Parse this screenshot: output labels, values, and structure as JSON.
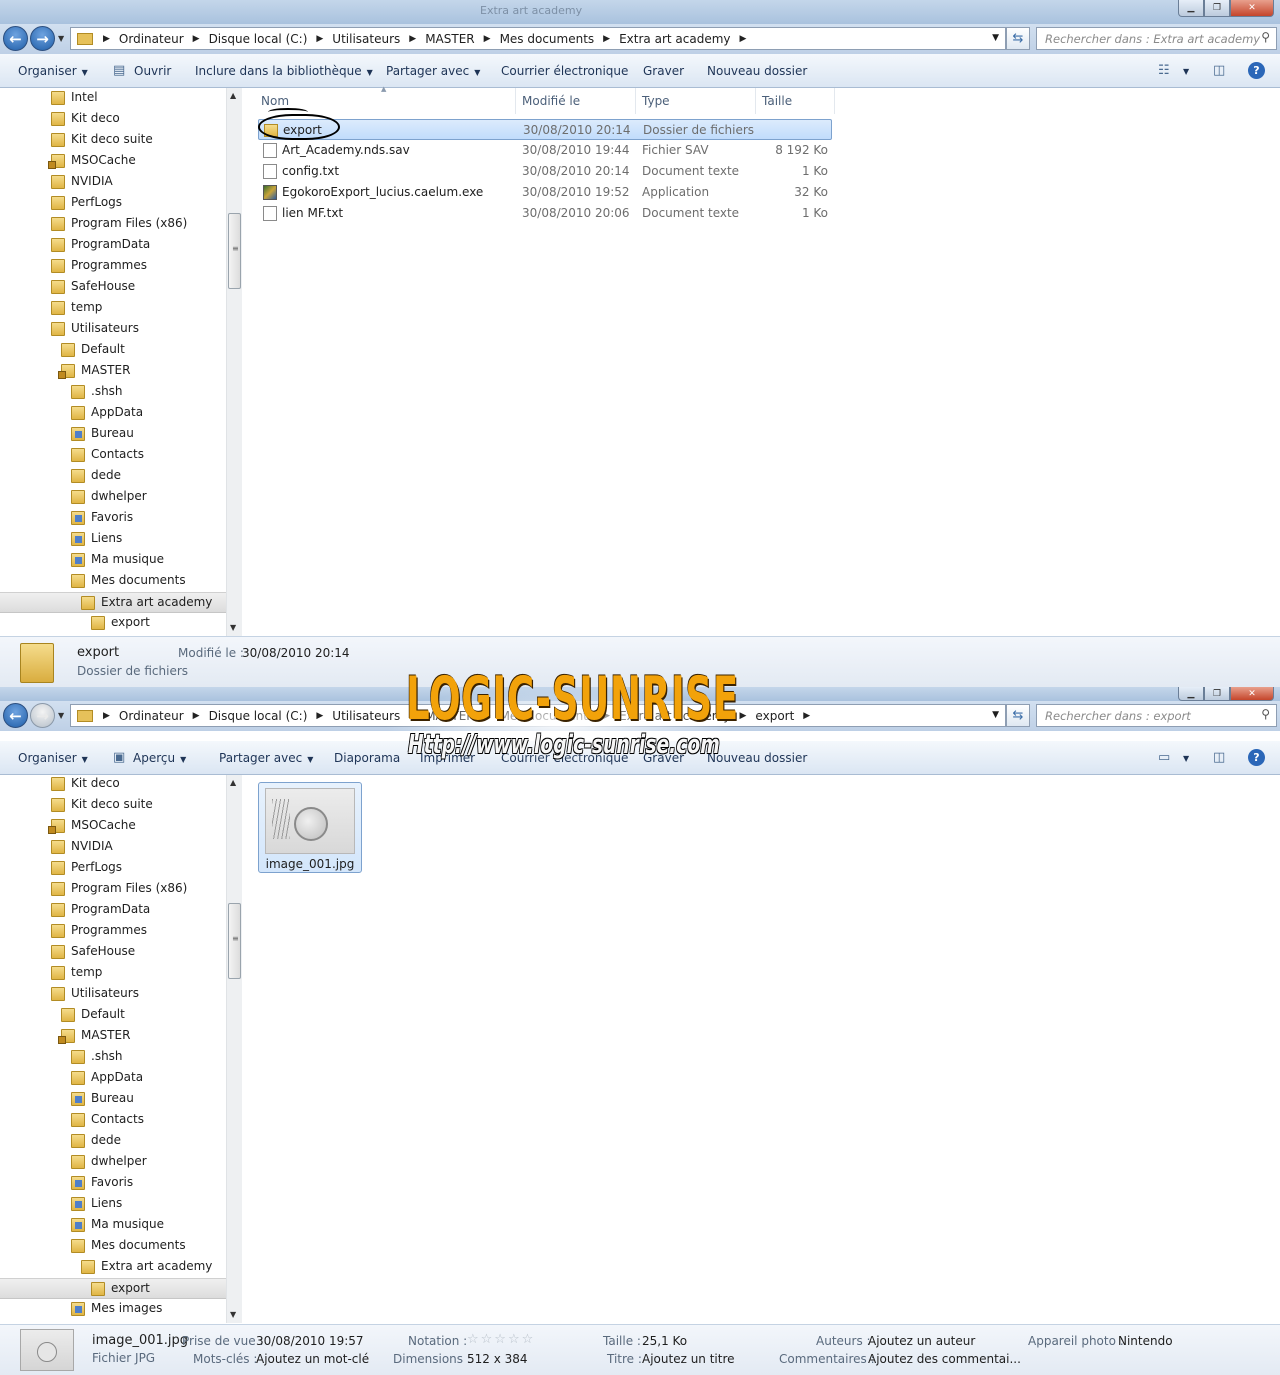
{
  "window1": {
    "title": "Extra art academy",
    "breadcrumb": [
      "Ordinateur",
      "Disque local (C:)",
      "Utilisateurs",
      "MASTER",
      "Mes documents",
      "Extra art academy"
    ],
    "search_placeholder": "Rechercher dans : Extra art academy",
    "toolbar": {
      "organize": "Organiser",
      "open": "Ouvrir",
      "library": "Inclure dans la bibliothèque",
      "share": "Partager avec",
      "email": "Courrier électronique",
      "burn": "Graver",
      "new_folder": "Nouveau dossier"
    },
    "tree": [
      "Intel",
      "Kit deco",
      "Kit deco suite",
      "MSOCache",
      "NVIDIA",
      "PerfLogs",
      "Program Files (x86)",
      "ProgramData",
      "Programmes",
      "SafeHouse",
      "temp",
      "Utilisateurs",
      "Default",
      "MASTER",
      ".shsh",
      "AppData",
      "Bureau",
      "Contacts",
      "dede",
      "dwhelper",
      "Favoris",
      "Liens",
      "Ma musique",
      "Mes documents",
      "Extra art academy",
      "export"
    ],
    "columns": {
      "name": "Nom",
      "modified": "Modifié le",
      "type": "Type",
      "size": "Taille"
    },
    "files": [
      {
        "name": "export",
        "modified": "30/08/2010 20:14",
        "type": "Dossier de fichiers",
        "size": ""
      },
      {
        "name": "Art_Academy.nds.sav",
        "modified": "30/08/2010 19:44",
        "type": "Fichier SAV",
        "size": "8 192 Ko"
      },
      {
        "name": "config.txt",
        "modified": "30/08/2010 20:14",
        "type": "Document texte",
        "size": "1 Ko"
      },
      {
        "name": "EgokoroExport_lucius.caelum.exe",
        "modified": "30/08/2010 19:52",
        "type": "Application",
        "size": "32 Ko"
      },
      {
        "name": "lien MF.txt",
        "modified": "30/08/2010 20:06",
        "type": "Document texte",
        "size": "1 Ko"
      }
    ],
    "details": {
      "name": "export",
      "type": "Dossier de fichiers",
      "modified_label": "Modifié le :",
      "modified_value": "30/08/2010 20:14"
    }
  },
  "window2": {
    "breadcrumb": [
      "Ordinateur",
      "Disque local (C:)",
      "Utilisateurs",
      "MASTER",
      "Mes documents",
      "Extra art academy",
      "export"
    ],
    "search_placeholder": "Rechercher dans : export",
    "toolbar": {
      "organize": "Organiser",
      "preview": "Aperçu",
      "share": "Partager avec",
      "slideshow": "Diaporama",
      "print": "Imprimer",
      "email": "Courrier électronique",
      "burn": "Graver",
      "new_folder": "Nouveau dossier"
    },
    "tree": [
      "Kit deco",
      "Kit deco suite",
      "MSOCache",
      "NVIDIA",
      "PerfLogs",
      "Program Files (x86)",
      "ProgramData",
      "Programmes",
      "SafeHouse",
      "temp",
      "Utilisateurs",
      "Default",
      "MASTER",
      ".shsh",
      "AppData",
      "Bureau",
      "Contacts",
      "dede",
      "dwhelper",
      "Favoris",
      "Liens",
      "Ma musique",
      "Mes documents",
      "Extra art academy",
      "export",
      "Mes images"
    ],
    "file": {
      "name": "image_001.jpg"
    },
    "details": {
      "name": "image_001.jpg",
      "type": "Fichier JPG",
      "taken_label": "Prise de vue :",
      "taken_value": "30/08/2010 19:57",
      "keywords_label": "Mots-clés :",
      "keywords_value": "Ajoutez un mot-clé",
      "rating_label": "Notation :",
      "rating_value": 0,
      "dimensions_label": "Dimensions :",
      "dimensions_value": "512 x 384",
      "size_label": "Taille :",
      "size_value": "25,1 Ko",
      "title_label": "Titre :",
      "title_value": "Ajoutez un titre",
      "authors_label": "Auteurs :",
      "authors_value": "Ajoutez un auteur",
      "comments_label": "Commentaires :",
      "comments_value": "Ajoutez des commentai...",
      "camera_label": "Appareil photo :",
      "camera_value": "Nintendo"
    }
  },
  "watermark": {
    "logo": "LOGIC-SUNRISE",
    "url": "Http://www.logic-sunrise.com"
  },
  "colors": {
    "selection": "#c1dcfc",
    "selection_border": "#7da2ce",
    "folder": "#e0b545",
    "accent": "#2b67b8",
    "watermark_orange": "#f2a20a"
  }
}
